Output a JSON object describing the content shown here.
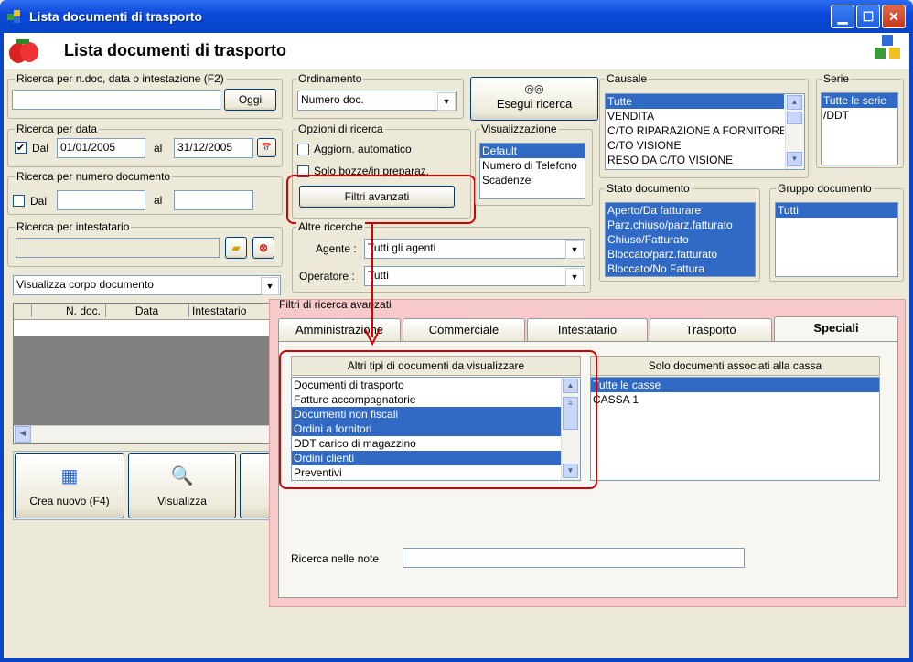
{
  "window": {
    "title": "Lista documenti di trasporto"
  },
  "header": {
    "title": "Lista documenti di trasporto"
  },
  "search_ndoc": {
    "label": "Ricerca per n.doc, data o intestazione (F2)",
    "value": "",
    "button": "Oggi"
  },
  "search_date": {
    "label": "Ricerca per data",
    "checked": true,
    "dal_label": "Dal",
    "from": "01/01/2005",
    "al_label": "al",
    "to": "31/12/2005"
  },
  "search_num": {
    "label": "Ricerca per numero documento",
    "checked": false,
    "dal_label": "Dal",
    "from": "",
    "al_label": "al",
    "to": ""
  },
  "search_owner": {
    "label": "Ricerca per intestatario",
    "value": ""
  },
  "body_combo": {
    "value": "Visualizza corpo documento"
  },
  "grid": {
    "columns": [
      "N. doc.",
      "Data",
      "Intestatario"
    ]
  },
  "buttons": {
    "new": "Crea nuovo (F4)",
    "view": "Visualizza"
  },
  "ordering": {
    "label": "Ordinamento",
    "value": "Numero doc."
  },
  "run_search": {
    "label": "Esegui ricerca"
  },
  "options": {
    "label": "Opzioni di ricerca",
    "auto": "Aggiorn. automatico",
    "drafts": "Solo bozze/in preparaz.",
    "advanced": "Filtri avanzati"
  },
  "display": {
    "label": "Visualizzazione",
    "items": [
      "Default",
      "Numero di Telefono",
      "Scadenze"
    ]
  },
  "other": {
    "label": "Altre ricerche",
    "agent_label": "Agente :",
    "agent": "Tutti gli agenti",
    "operator_label": "Operatore :",
    "operator": "Tutti"
  },
  "causale": {
    "label": "Causale",
    "items": [
      "Tutte",
      "VENDITA",
      "C/TO RIPARAZIONE A FORNITORE",
      "C/TO VISIONE",
      "RESO DA C/TO VISIONE"
    ]
  },
  "serie": {
    "label": "Serie",
    "items": [
      "Tutte le serie",
      "/DDT"
    ]
  },
  "stato": {
    "label": "Stato documento",
    "items": [
      "Aperto/Da fatturare",
      "Parz.chiuso/parz.fatturato",
      "Chiuso/Fatturato",
      "Bloccato/parz.fatturato",
      "Bloccato/No Fattura"
    ]
  },
  "gruppo": {
    "label": "Gruppo documento",
    "items": [
      "Tutti"
    ]
  },
  "advanced": {
    "label": "Filtri di ricerca avanzati",
    "tabs": [
      "Amministrazione",
      "Commerciale",
      "Intestatario",
      "Trasporto",
      "Speciali"
    ],
    "doc_types_header": "Altri tipi di documenti da visualizzare",
    "doc_types": [
      "Documenti di trasporto",
      "Fatture accompagnatorie",
      "Documenti non fiscali",
      "Ordini a fornitori",
      "DDT carico di magazzino",
      "Ordini clienti",
      "Preventivi"
    ],
    "cash_header": "Solo documenti associati alla cassa",
    "cash": [
      "Tutte le casse",
      "CASSA 1"
    ],
    "notes_label": "Ricerca nelle note",
    "notes_value": ""
  },
  "colors": {
    "accent": "#316ac5",
    "highlight": "#d40000",
    "panel": "#f7c9c9"
  }
}
